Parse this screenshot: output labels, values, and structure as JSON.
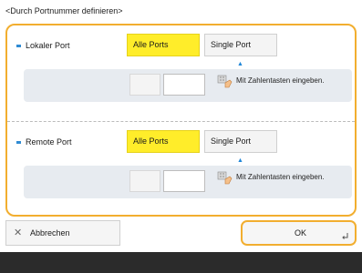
{
  "page": {
    "title": "<Durch Portnummer definieren>"
  },
  "sections": [
    {
      "label": "Lokaler Port",
      "options": [
        {
          "label": "Alle Ports",
          "selected": true
        },
        {
          "label": "Single Port",
          "selected": false
        }
      ],
      "hint": "Mit Zahlentasten eingeben.",
      "value": ""
    },
    {
      "label": "Remote Port",
      "options": [
        {
          "label": "Alle Ports",
          "selected": true
        },
        {
          "label": "Single Port",
          "selected": false
        }
      ],
      "hint": "Mit Zahlentasten eingeben.",
      "value": ""
    }
  ],
  "footer": {
    "cancel_label": "Abbrechen",
    "ok_label": "OK"
  },
  "icons": {
    "cancel": "close-x-icon",
    "ok": "return-enter-icon",
    "hint": "keypad-hand-icon",
    "caret": "caret-up-icon"
  },
  "colors": {
    "accent": "#f2ae2f",
    "selected": "#ffed2a",
    "bullet": "#2f8bd3",
    "band": "#e7ebf0"
  }
}
